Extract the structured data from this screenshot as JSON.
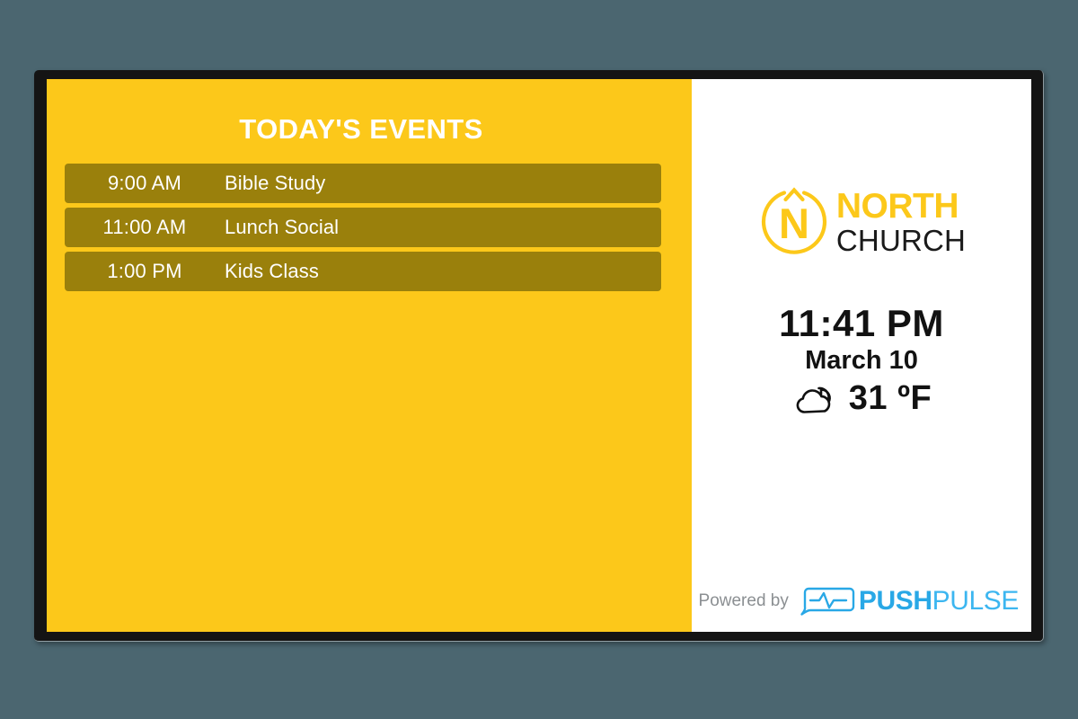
{
  "events_panel": {
    "title": "TODAY'S EVENTS",
    "events": [
      {
        "time": "9:00 AM",
        "name": "Bible Study"
      },
      {
        "time": "11:00 AM",
        "name": "Lunch Social"
      },
      {
        "time": "1:00 PM",
        "name": "Kids Class"
      }
    ]
  },
  "info_panel": {
    "logo": {
      "mark_letter": "N",
      "name_top": "NORTH",
      "name_bottom": "CHURCH"
    },
    "clock": {
      "time": "11:41 PM",
      "date": "March 10"
    },
    "weather": {
      "icon": "cloud-icon",
      "temperature": "31 ºF"
    }
  },
  "footer": {
    "powered_by": "Powered by",
    "brand_first": "PUSH",
    "brand_second": "PULSE",
    "icon": "pulse-bubble-icon"
  },
  "colors": {
    "background": "#4b6670",
    "bezel": "#141414",
    "brand_yellow": "#fcc81a",
    "event_row": "#9a800c",
    "panel_white": "#ffffff",
    "text_dark": "#121212",
    "footer_gray": "#8b8f92",
    "pushpulse_blue": "#29a8e6",
    "pushpulse_blue_light": "#3cb6f0"
  }
}
